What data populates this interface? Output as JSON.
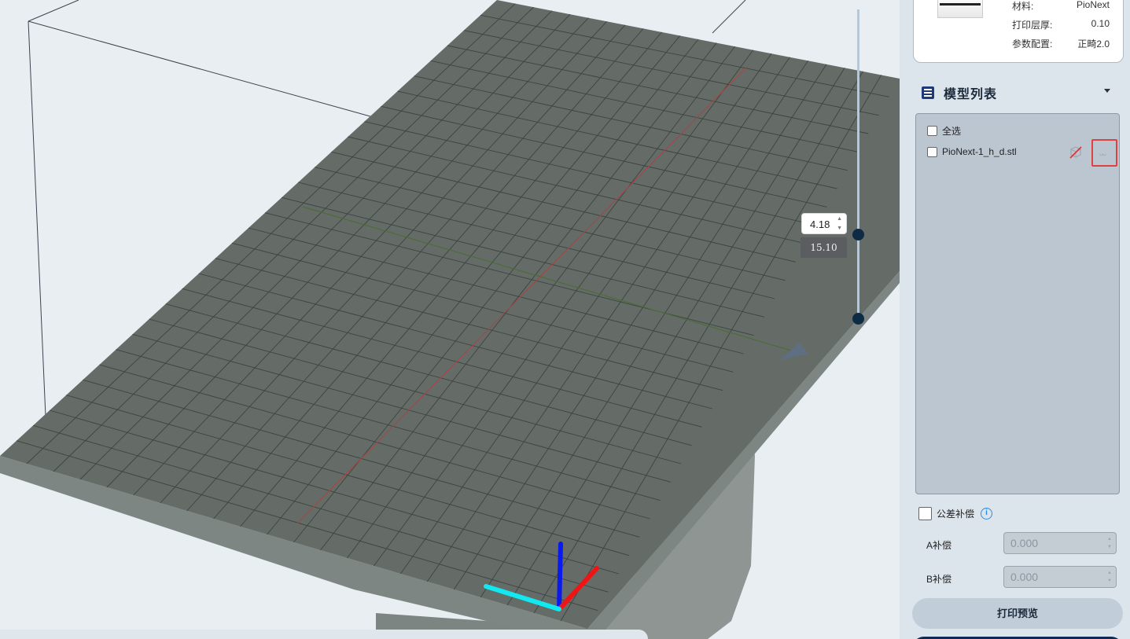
{
  "viewport": {
    "layer_value": "4.18",
    "layer_height": "15.10"
  },
  "printer_card": {
    "specs": [
      {
        "label": "材料:",
        "value": "PioNext"
      },
      {
        "label": "打印层厚:",
        "value": "0.10"
      },
      {
        "label": "参数配置:",
        "value": "正畸2.0"
      }
    ]
  },
  "model_list": {
    "title": "模型列表",
    "select_all": "全选",
    "items": [
      {
        "name": "PioNext-1_h_d.stl"
      }
    ]
  },
  "tolerance": {
    "label": "公差补偿",
    "a_label": "A补偿",
    "a_value": "0.000",
    "b_label": "B补偿",
    "b_value": "0.000"
  },
  "actions": {
    "preview": "打印预览"
  },
  "colors": {
    "accent": "#1e3a78",
    "highlight": "#e04040",
    "plate": "#687068"
  }
}
